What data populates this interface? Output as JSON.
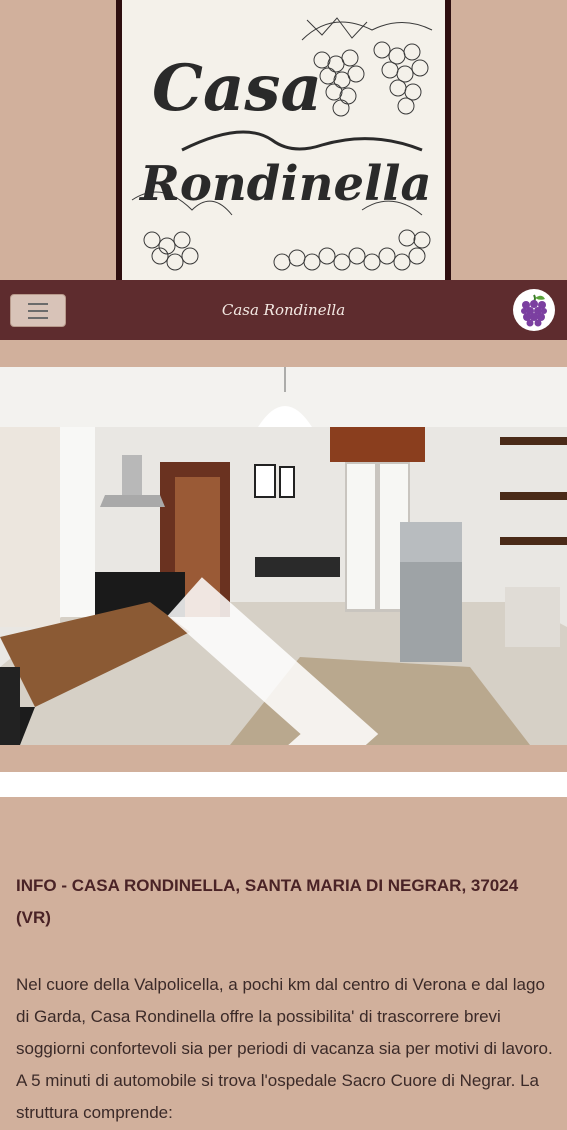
{
  "logo": {
    "line1": "Casa",
    "line2": "Rondinella"
  },
  "navbar": {
    "brand": "Casa Rondinella",
    "menu_icon": "hamburger-icon",
    "badge_icon": "grapes-icon"
  },
  "carousel": {
    "next_icon": "chevron-right-icon"
  },
  "info": {
    "heading": "INFO - CASA RONDINELLA, SANTA MARIA DI NEGRAR, 37024 (VR)",
    "body": "Nel cuore della Valpolicella, a pochi km dal centro di Verona e dal lago di Garda, Casa Rondinella offre la possibilita' di trascorrere brevi soggiorni confortevoli sia per periodi di vacanza sia per motivi di lavoro. A 5 minuti di automobile si trova l'ospedale Sacro Cuore di Negrar. La struttura comprende:"
  },
  "colors": {
    "background": "#d1b09c",
    "navbar": "#5e2c2e",
    "text": "#3b2a28"
  }
}
